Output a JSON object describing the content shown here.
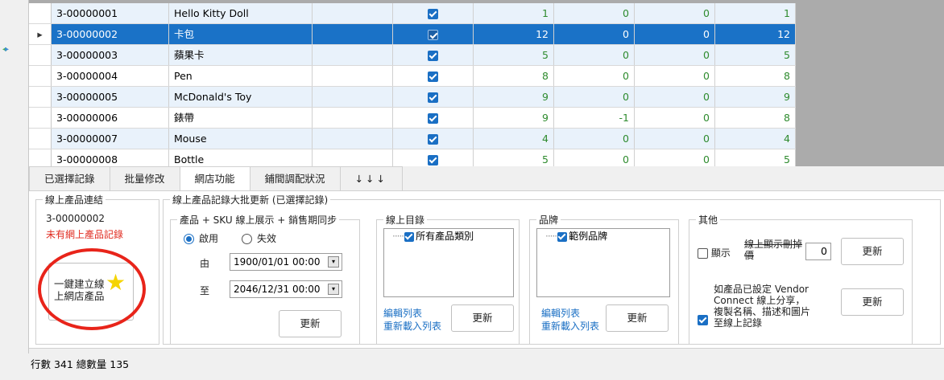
{
  "grid": {
    "rows": [
      {
        "code": "3-00000001",
        "name": "Hello Kitty Doll",
        "checked": true,
        "n1": "1",
        "n2": "0",
        "n3": "0",
        "n4": "1",
        "selected": false
      },
      {
        "code": "3-00000002",
        "name": "卡包",
        "checked": true,
        "n1": "12",
        "n2": "0",
        "n3": "0",
        "n4": "12",
        "selected": true
      },
      {
        "code": "3-00000003",
        "name": "蘋果卡",
        "checked": true,
        "n1": "5",
        "n2": "0",
        "n3": "0",
        "n4": "5",
        "selected": false
      },
      {
        "code": "3-00000004",
        "name": "Pen",
        "checked": true,
        "n1": "8",
        "n2": "0",
        "n3": "0",
        "n4": "8",
        "selected": false
      },
      {
        "code": "3-00000005",
        "name": "McDonald's Toy",
        "checked": true,
        "n1": "9",
        "n2": "0",
        "n3": "0",
        "n4": "9",
        "selected": false
      },
      {
        "code": "3-00000006",
        "name": "錶帶",
        "checked": true,
        "n1": "9",
        "n2": "-1",
        "n3": "0",
        "n4": "8",
        "selected": false
      },
      {
        "code": "3-00000007",
        "name": "Mouse",
        "checked": true,
        "n1": "4",
        "n2": "0",
        "n3": "0",
        "n4": "4",
        "selected": false
      },
      {
        "code": "3-00000008",
        "name": "Bottle",
        "checked": true,
        "n1": "5",
        "n2": "0",
        "n3": "0",
        "n4": "5",
        "selected": false
      }
    ]
  },
  "tabs": [
    {
      "label": "已選擇記錄",
      "active": false
    },
    {
      "label": "批量修改",
      "active": false
    },
    {
      "label": "網店功能",
      "active": true
    },
    {
      "label": "鋪間調配狀況",
      "active": false
    },
    {
      "label": "↓↓↓",
      "active": false
    }
  ],
  "online_link": {
    "legend": "線上產品連結",
    "code": "3-00000002",
    "status": "未有網上產品記錄",
    "create_button_line1": "一鍵建立線",
    "create_button_line2": "上網店產品"
  },
  "bulk_update": {
    "legend": "線上產品記錄大批更新 (已選擇記錄)",
    "sync": {
      "legend": "產品 + SKU 線上展示 + 銷售期同步",
      "enabled_label": "啟用",
      "disabled_label": "失效",
      "from_label": "由",
      "from_value": "1900/01/01 00:00",
      "to_label": "至",
      "to_value": "2046/12/31 00:00",
      "update_label": "更新"
    },
    "catalog": {
      "legend": "線上目錄",
      "tree_item": "所有產品類別",
      "edit_link": "編輯列表",
      "reload_link": "重新載入列表",
      "update_label": "更新"
    },
    "brand": {
      "legend": "品牌",
      "tree_item": "範例品牌",
      "edit_link": "編輯列表",
      "reload_link": "重新載入列表",
      "update_label": "更新"
    },
    "other": {
      "legend": "其他",
      "show_label": "顯示",
      "delete_label": "線上顯示刪掉價",
      "delete_value": "0",
      "update_label": "更新",
      "vendor_text": "如產品已設定 Vendor Connect 線上分享，複製名稱、描述和圖片至線上記錄",
      "vendor_update_label": "更新"
    }
  },
  "status_bar": {
    "text": "行數 341  總數量 135"
  },
  "colors": {
    "selection": "#1a72c7",
    "accent_red": "#e8241a",
    "link": "#1a6fc4"
  }
}
